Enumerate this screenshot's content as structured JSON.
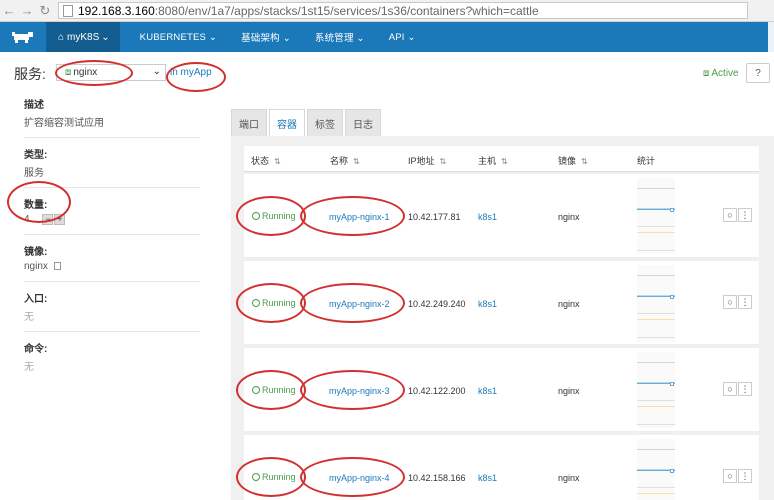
{
  "browser": {
    "url_host": "192.168.3.160",
    "url_rest": ":8080/env/1a7/apps/stacks/1st15/services/1s36/containers?which=cattle"
  },
  "topnav": {
    "env": "myK8S",
    "items": [
      "KUBERNETES",
      "基础架构",
      "系统管理",
      "API"
    ]
  },
  "header": {
    "title": "服务:",
    "service": "nginx",
    "stack_link": "in myApp",
    "state": "Active",
    "help": "?"
  },
  "details": {
    "desc_label": "描述",
    "desc_value": "扩容缩容测试应用",
    "type_label": "类型:",
    "type_value": "服务",
    "scale_label": "数量:",
    "scale_value": "4",
    "image_label": "镜像:",
    "image_value": "nginx",
    "entry_label": "入口:",
    "entry_value": "无",
    "cmd_label": "命令:",
    "cmd_value": "无"
  },
  "tabs": [
    "端口",
    "容器",
    "标签",
    "日志"
  ],
  "table": {
    "headers": [
      "状态",
      "名称",
      "IP地址",
      "主机",
      "镜像",
      "统计"
    ],
    "rows": [
      {
        "status": "Running",
        "name": "myApp-nginx-1",
        "ip": "10.42.177.81",
        "host": "k8s1",
        "image": "nginx"
      },
      {
        "status": "Running",
        "name": "myApp-nginx-2",
        "ip": "10.42.249.240",
        "host": "k8s1",
        "image": "nginx"
      },
      {
        "status": "Running",
        "name": "myApp-nginx-3",
        "ip": "10.42.122.200",
        "host": "k8s1",
        "image": "nginx"
      },
      {
        "status": "Running",
        "name": "myApp-nginx-4",
        "ip": "10.42.158.166",
        "host": "k8s1",
        "image": "nginx"
      }
    ]
  },
  "colors": {
    "brand": "#1b79b9",
    "running": "#4a9b4a",
    "annotation": "#d32f2f"
  }
}
